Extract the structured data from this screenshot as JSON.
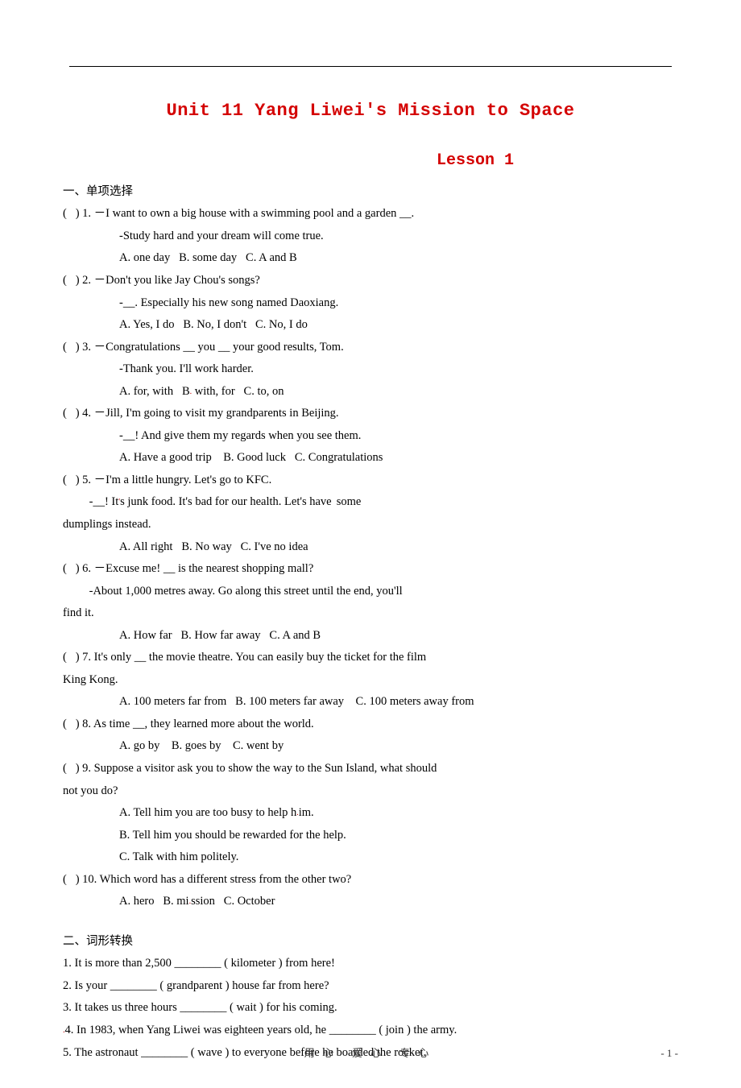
{
  "title": "Unit 11 Yang Liwei's Mission to Space",
  "subtitle": "Lesson 1",
  "section1_head": "一、单项选择",
  "q1_l1": "(   ) 1. －I want to own a big house with a swimming pool and a garden __.",
  "q1_l2": "-Study hard and your dream will come true.",
  "q1_opt": "A. one day   B. some day   C. A and B",
  "q2_l1": "(   ) 2. －Don't you like Jay Chou's songs?",
  "q2_l2": "-__. Especially his new song named Daoxiang.",
  "q2_opt": "A. Yes, I do   B. No, I don't   C. No, I do",
  "q3_l1": "(   ) 3. －Congratulations __ you __ your good results, Tom.",
  "q3_l2": "-Thank you. I'll work harder.",
  "q3_opt_a": "A. for, with   B",
  "q3_opt_b": " with, for   C. to, on",
  "q4_l1": "(   ) 4. －Jill, I'm going to visit my grandparents in Beijing.",
  "q4_l2": "-__! And give them my regards when you see them.",
  "q4_opt": "A. Have a good trip    B. Good luck   C. Congratulations",
  "q5_l1": "(   ) 5. －I'm a little hungry. Let's go to KFC.",
  "q5_l2a": "         -__! It",
  "q5_l2b": "s junk food. It's bad for our health. Let's have",
  "q5_l2c": " some",
  "q5_l3": "dumplings instead.",
  "q5_opt": "A. All right   B. No way   C. I've no idea",
  "q6_l1": "(   ) 6. －Excuse me! __ is the nearest shopping mall?",
  "q6_l2": "         -About 1,000 metres away. Go along this street until the end, you'll",
  "q6_l3": "find it.",
  "q6_opt": "A. How far   B. How far away   C. A and B",
  "q7_l1": "(   ) 7. It's only __ the movie theatre. You can easily buy the ticket for the film",
  "q7_l2": "King Kong.",
  "q7_opt": "A. 100 meters far from   B. 100 meters far away    C. 100 meters away from",
  "q8_l1": "(   ) 8. As time __, they learned more about the world.",
  "q8_opt": "A. go by    B. goes by    C. went by",
  "q9_l1": "(   ) 9. Suppose a visitor ask you to show the way to the Sun Island, what should",
  "q9_l2": "not you do?",
  "q9_opt_a": "A. Tell him you are too busy to help h",
  "q9_opt_a2": "im.",
  "q9_opt_b": "B. Tell him you should be rewarded for the help.",
  "q9_opt_c": "C. Talk with him politely.",
  "q10_l1": "(   ) 10. Which word has a different stress from the other two?",
  "q10_opt_a": "A. hero   B. mi",
  "q10_opt_b": "ssion   C. October",
  "section2_head": "二、词形转换",
  "f1": "1. It is more than 2,500 ________ ( kilometer ) from here!",
  "f2": "2. Is your ________ ( grandparent ) house far from here?",
  "f3": "3. It takes us three hours ________ ( wait ) for his coming.",
  "f4a": "4. In 1983, when Yang Liwei was eighteen years old, he ________ ( join ) the army.",
  "f5": "5. The astronaut ________ ( wave ) to everyone before he boarded the rocket.",
  "footer_center": "用心 爱心 专心",
  "footer_page": "- 1 -"
}
